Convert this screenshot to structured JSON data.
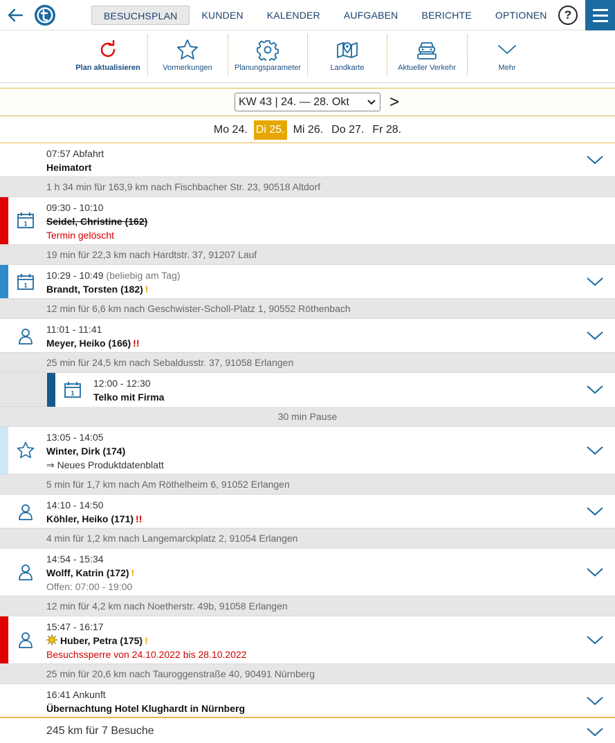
{
  "nav": {
    "tabs": [
      {
        "label": "BESUCHSPLAN",
        "active": true
      },
      {
        "label": "KUNDEN",
        "active": false
      },
      {
        "label": "KALENDER",
        "active": false
      },
      {
        "label": "AUFGABEN",
        "active": false
      },
      {
        "label": "BERICHTE",
        "active": false
      },
      {
        "label": "OPTIONEN",
        "active": false
      }
    ],
    "help_label": "?"
  },
  "toolbar": {
    "items": [
      {
        "label": "Plan aktualisieren",
        "icon": "refresh-icon"
      },
      {
        "label": "Vormerkungen",
        "icon": "star-icon"
      },
      {
        "label": "Planungsparameter",
        "icon": "gear-icon"
      },
      {
        "label": "Landkarte",
        "icon": "map-icon"
      },
      {
        "label": "Aktueller Verkehr",
        "icon": "traffic-icon"
      },
      {
        "label": "Mehr",
        "icon": "chevron-down-icon"
      }
    ]
  },
  "week": {
    "selected": "KW 43 | 24. — 28. Okt",
    "next_label": ">"
  },
  "days": [
    {
      "label": "Mo 24.",
      "selected": false
    },
    {
      "label": "Di 25.",
      "selected": true
    },
    {
      "label": "Mi 26.",
      "selected": false
    },
    {
      "label": "Do 27.",
      "selected": false
    },
    {
      "label": "Fr 28.",
      "selected": false
    }
  ],
  "plan": {
    "start": {
      "time": "07:57 Abfahrt",
      "name": "Heimatort"
    },
    "drive1": "1 h 34 min für 163,9 km nach Fischbacher Str. 23, 90518 Altdorf",
    "v1": {
      "time": "09:30 - 10:10",
      "name": "Seidel, Christine (162)",
      "note": "Termin gelöscht"
    },
    "drive2": "19 min für 22,3 km nach Hardtstr. 37, 91207 Lauf",
    "v2": {
      "time": "10:29 - 10:49",
      "time_extra": "(beliebig am Tag)",
      "name": "Brandt, Torsten (182)",
      "flag": "!"
    },
    "drive3": "12 min für 6,6 km nach Geschwister-Scholl-Platz 1, 90552 Röthenbach",
    "v3": {
      "time": "11:01 - 11:41",
      "name": "Meyer, Heiko (166)",
      "flag": "!!"
    },
    "drive4": "25 min für 24,5 km nach Sebaldusstr. 37, 91058 Erlangen",
    "v4": {
      "time": "12:00 - 12:30",
      "name": "Telko mit Firma"
    },
    "pause": "30 min Pause",
    "v5": {
      "time": "13:05 - 14:05",
      "name": "Winter, Dirk (174)",
      "note": "⇒ Neues Produktdatenblatt"
    },
    "drive5": "5 min für 1,7 km nach Am Röthelheim 6, 91052 Erlangen",
    "v6": {
      "time": "14:10 - 14:50",
      "name": "Köhler, Heiko (171)",
      "flag": "!!"
    },
    "drive6": "4 min für 1,2 km nach Langemarckplatz 2, 91054 Erlangen",
    "v7": {
      "time": "14:54 - 15:34",
      "name": "Wolff, Katrin (172)",
      "flag": "!",
      "note": "Offen: 07:00 - 19:00"
    },
    "drive7": "12 min für 4,2 km nach Noetherstr. 49b, 91058 Erlangen",
    "v8": {
      "time": "15:47 - 16:17",
      "name": "Huber, Petra (175)",
      "flag": "!",
      "note": "Besuchssperre von 24.10.2022 bis 28.10.2022"
    },
    "drive8": "25 min für 20,6 km nach Tauroggenstraße 40, 90491 Nürnberg",
    "end": {
      "time": "16:41 Ankunft",
      "name": "Übernachtung Hotel Klughardt in Nürnberg"
    }
  },
  "footer": {
    "summary": "245 km für 7 Besuche"
  },
  "colors": {
    "accent": "#1b6aa0",
    "bar_red": "#e00000",
    "bar_blue": "#2e8bc8",
    "bar_dark": "#155a8a",
    "bar_light": "#cde7f7",
    "day_selected": "#e6a800"
  }
}
